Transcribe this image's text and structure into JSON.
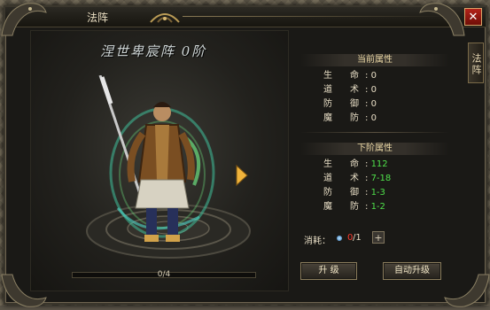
{
  "window": {
    "title": "法阵",
    "close_label": "✕",
    "side_tab": "法阵"
  },
  "formation": {
    "name": "涅世卑宸阵 0阶"
  },
  "progress": {
    "text": "0/4",
    "fraction": 0
  },
  "current_attrs": {
    "header": "当前属性",
    "rows": [
      {
        "k": "生　　命",
        "v": "0"
      },
      {
        "k": "道　　术",
        "v": "0"
      },
      {
        "k": "防　　御",
        "v": "0"
      },
      {
        "k": "魔　　防",
        "v": "0"
      }
    ]
  },
  "next_attrs": {
    "header": "下阶属性",
    "rows": [
      {
        "k": "生　　命",
        "v": "112"
      },
      {
        "k": "道　　术",
        "v": "7-18"
      },
      {
        "k": "防　　御",
        "v": "1-3"
      },
      {
        "k": "魔　　防",
        "v": "1-2"
      }
    ]
  },
  "cost": {
    "label": "消耗：",
    "have": "0",
    "need": "/1",
    "plus": "+"
  },
  "buttons": {
    "upgrade": "升 级",
    "auto_upgrade": "自动升级"
  },
  "colors": {
    "green": "#4fe04a",
    "red": "#ff3b2f",
    "gold": "#e9d6a4"
  }
}
